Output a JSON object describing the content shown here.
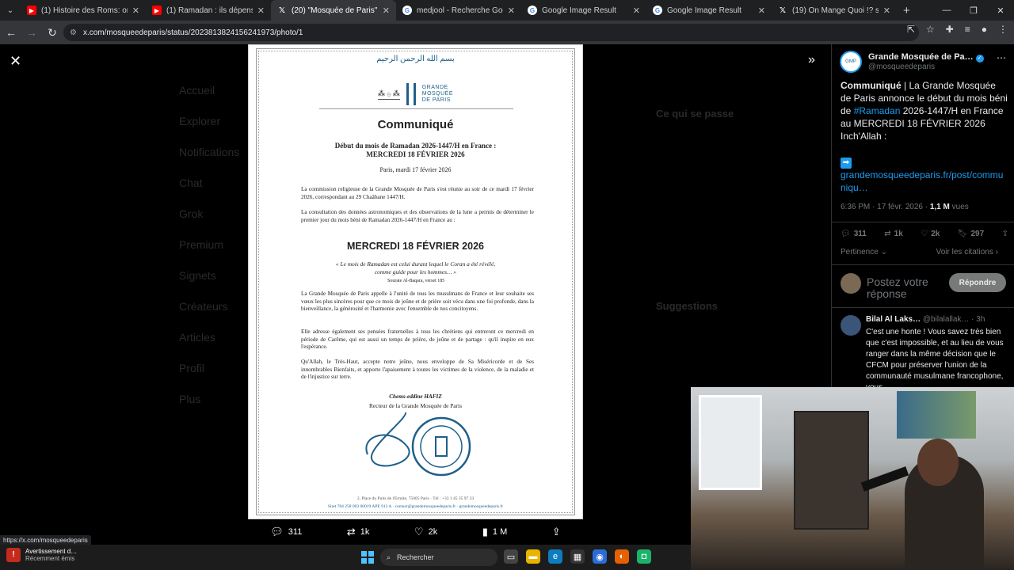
{
  "browser": {
    "tabs": [
      {
        "title": "(1) Histoire des Roms: origine et",
        "favicon": "youtube-icon",
        "active": false
      },
      {
        "title": "(1) Ramadan : ils dépensent jus",
        "favicon": "youtube-icon",
        "active": false
      },
      {
        "title": "(20) \"Mosquée de Paris\" - Rech",
        "favicon": "x-icon",
        "active": true
      },
      {
        "title": "medjool - Recherche Google",
        "favicon": "google-icon",
        "active": false
      },
      {
        "title": "Google Image Result",
        "favicon": "google-icon",
        "active": false
      },
      {
        "title": "Google Image Result",
        "favicon": "google-icon",
        "active": false
      },
      {
        "title": "(19) On Mange Quoi !? sur X : \"",
        "favicon": "x-icon",
        "active": false
      }
    ],
    "url": "x.com/mosqueedeparis/status/2023813824156241973/photo/1",
    "status_url": "https://x.com/mosqueedeparis"
  },
  "document": {
    "basmala": "بسم الله الرحمن الرحيم",
    "logo_name_1": "GRANDE",
    "logo_name_2": "MOSQUÉE",
    "logo_name_3": "DE PARIS",
    "title": "Communiqué",
    "subtitle_1": "Début du mois de Ramadan 2026-1447/H en France :",
    "subtitle_2": "MERCREDI 18 FÉVRIER 2026",
    "date": "Paris, mardi 17 février 2026",
    "para1": "La commission religieuse de la Grande Mosquée de Paris s'est réunie au soir de ce mardi 17 février 2026, correspondant au 29 Chaâbane 1447/H.",
    "para2": "La consultation des données astronomiques et des observations de la lune a permis de déterminer le premier jour du mois béni de Ramadan 2026-1447/H en France au :",
    "big_date": "MERCREDI 18 FÉVRIER 2026",
    "quote_1": "« Le mois de Ramadan est celui durant lequel le Coran a été révélé,",
    "quote_2": "comme guide pour les hommes… »",
    "quote_ref": "Sourate Al-Baqara, verset 185",
    "para3": "La Grande Mosquée de Paris appelle à l'unité de tous les musulmans de France et leur souhaite ses vœux les plus sincères pour que ce mois de jeûne et de prière soit vécu dans une foi profonde, dans la bienveillance, la générosité et l'harmonie avec l'ensemble de nos concitoyens.",
    "para4": "Elle adresse également ses pensées fraternelles à tous les chrétiens qui entreront ce mercredi en période de Carême, qui est aussi un temps de prière, de jeûne et de partage : qu'il inspire en eux l'espérance.",
    "para5": "Qu'Allah, le Très-Haut, accepte notre jeûne, nous enveloppe de Sa Miséricorde et de Ses innombrables Bienfaits, et apporte l'apaisement à toutes les victimes de la violence, de la maladie et de l'injustice sur terre.",
    "signatory": "Chems-eddine HAFIZ",
    "signatory_role": "Recteur de la Grande Mosquée de Paris",
    "footer_1": "2, Place du Puits de l'Ermite, 75005 Paris · Tél : +33 1 45 35 97 33",
    "footer_2": "Siret 784 258 003 00019 APE 913 A · contact@grandemosqueedeparis.fr · grandemosqueedeparis.fr"
  },
  "photo_actions": {
    "replies": "311",
    "reposts": "1k",
    "likes": "2k",
    "views": "1 M"
  },
  "post": {
    "author": "Grande Mosquée de Pa…",
    "handle": "@mosqueedeparis",
    "text_bold": "Communiqué",
    "text_1": " | La Grande Mosquée de Paris annonce le début du mois béni de ",
    "hashtag": "#Ramadan",
    "text_2": " 2026-1447/H en France au MERCREDI 18 FÉVRIER 2026 Inch'Allah :",
    "link": "grandemosqueedeparis.fr/post/communiqu…",
    "time": "6:36 PM · 17 févr. 2026 · ",
    "views_count": "1,1 M",
    "views_label": " vues",
    "stat_replies": "311",
    "stat_reposts": "1k",
    "stat_likes": "2k",
    "stat_bookmarks": "297",
    "sort_label": "Pertinence",
    "quotes_label": "Voir les citations",
    "reply_placeholder": "Postez votre réponse",
    "reply_button": "Répondre"
  },
  "reply": {
    "author": "Bilal Al Laks…",
    "handle": " @bilalallak…",
    "time": " · 3h",
    "text": "C'est une honte ! Vous savez très bien que c'est impossible, et au lieu de vous ranger dans la même décision que le CFCM pour préserver l'union de la communauté musulmane francophone, vous"
  },
  "background_nav": [
    "Accueil",
    "Explorer",
    "Notifications",
    "Chat",
    "Grok",
    "Premium",
    "Signets",
    "Créateurs",
    "Articles",
    "Profil",
    "Plus"
  ],
  "background_side": {
    "heading": "Ce qui se passe",
    "suggestions": "Suggestions"
  },
  "taskbar": {
    "notif_title": "Avertissement d…",
    "notif_sub": "Récemment émis",
    "search_label": "Rechercher"
  },
  "colors": {
    "accent": "#1d9bf0",
    "mosque_blue": "#1f5f8a"
  }
}
